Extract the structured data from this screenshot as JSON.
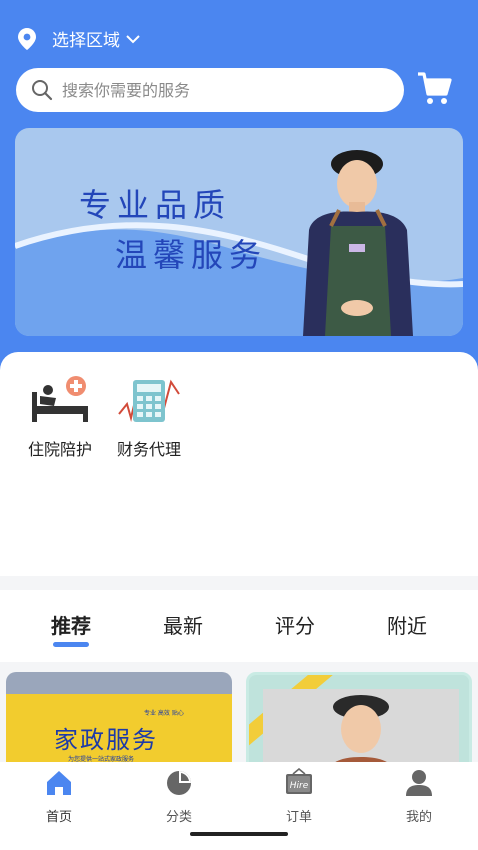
{
  "header": {
    "location_label": "选择区域",
    "search_placeholder": "搜索你需要的服务"
  },
  "banner": {
    "line1": "专业品质",
    "line2": "温馨服务"
  },
  "services": [
    {
      "label": "住院陪护",
      "icon": "hospital-bed-icon"
    },
    {
      "label": "财务代理",
      "icon": "calculator-icon"
    }
  ],
  "tabs": [
    {
      "label": "推荐",
      "active": true
    },
    {
      "label": "最新",
      "active": false
    },
    {
      "label": "评分",
      "active": false
    },
    {
      "label": "附近",
      "active": false
    }
  ],
  "cards": [
    {
      "title": "家政服务",
      "small_top": "专业 高效 贴心",
      "small_bottom": "为您提供一站式家政服务"
    }
  ],
  "bottom_nav": [
    {
      "label": "首页",
      "icon": "home-icon",
      "active": true
    },
    {
      "label": "分类",
      "icon": "pie-chart-icon",
      "active": false
    },
    {
      "label": "订单",
      "icon": "hire-sign-icon",
      "active": false
    },
    {
      "label": "我的",
      "icon": "user-icon",
      "active": false
    }
  ],
  "colors": {
    "primary": "#4b86f0",
    "banner_bg": "#a9c8ee",
    "card_yellow": "#f2cc2e"
  }
}
